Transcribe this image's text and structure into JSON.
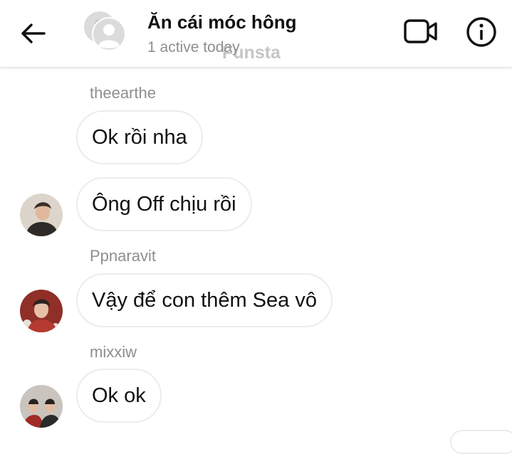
{
  "header": {
    "title": "Ăn cái móc hông",
    "subtitle": "1 active today",
    "watermark": "Funsta"
  },
  "icons": {
    "back": "arrow-left-icon",
    "group_avatar": "group-avatar-icon",
    "video": "video-camera-icon",
    "info": "info-icon"
  },
  "messages": [
    {
      "sender": "theearthe",
      "text": "Ok rồi nha"
    },
    {
      "sender": "",
      "text": "Ông Off chịu rồi"
    },
    {
      "sender": "Ppnaravit",
      "text": "Vậy để con thêm Sea vô"
    },
    {
      "sender": "mixxiw",
      "text": "Ok ok"
    }
  ],
  "colors": {
    "bubble_border": "#ececec",
    "secondary_text": "#8e8e8e"
  }
}
